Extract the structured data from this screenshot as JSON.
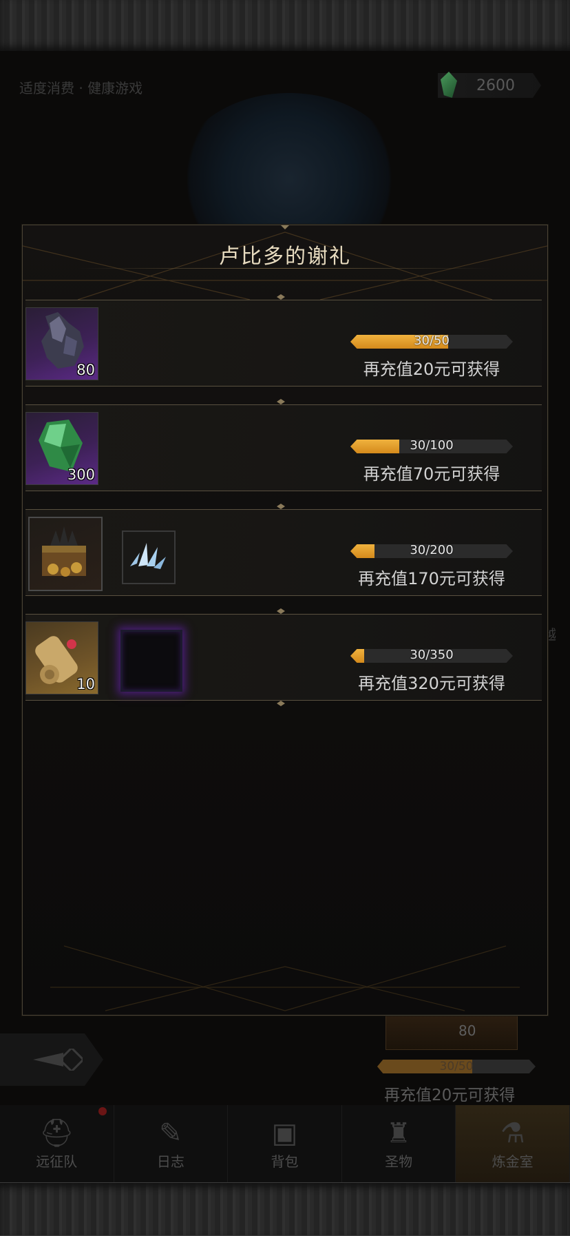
{
  "background": {
    "top_text": "适度消费 · 健康游戏",
    "currency_value": "2600",
    "side_char": "越",
    "lower_item_count": "80",
    "lower_progress": {
      "text": "30/50",
      "fraction": 0.6
    },
    "lower_hint": "再充值20元可获得"
  },
  "modal": {
    "title": "卢比多的谢礼",
    "rows": [
      {
        "items": [
          {
            "name": "dark-ore",
            "count": "80",
            "rarity": "purple"
          }
        ],
        "progress": {
          "current": 30,
          "target": 50,
          "text": "30/50",
          "fraction": 0.6
        },
        "hint": "再充值20元可获得"
      },
      {
        "items": [
          {
            "name": "green-crystal",
            "count": "300",
            "rarity": "purple"
          }
        ],
        "progress": {
          "current": 30,
          "target": 100,
          "text": "30/100",
          "fraction": 0.3
        },
        "hint": "再充值70元可获得"
      },
      {
        "items": [
          {
            "name": "treasure-chest",
            "count": "",
            "rarity": "dark"
          },
          {
            "name": "ice-crystal",
            "count": "",
            "rarity": "plain"
          }
        ],
        "progress": {
          "current": 30,
          "target": 200,
          "text": "30/200",
          "fraction": 0.15
        },
        "hint": "再充值170元可获得"
      },
      {
        "items": [
          {
            "name": "scroll",
            "count": "10",
            "rarity": "gold"
          },
          {
            "name": "void-frame",
            "count": "",
            "rarity": "void"
          }
        ],
        "progress": {
          "current": 30,
          "target": 350,
          "text": "30/350",
          "fraction": 0.0857
        },
        "hint": "再充值320元可获得"
      }
    ]
  },
  "nav": {
    "items": [
      {
        "label": "远征队",
        "icon": "helmet-icon"
      },
      {
        "label": "日志",
        "icon": "journal-icon"
      },
      {
        "label": "背包",
        "icon": "backpack-icon"
      },
      {
        "label": "圣物",
        "icon": "relic-icon"
      },
      {
        "label": "炼金室",
        "icon": "alchemy-icon",
        "active": true
      }
    ]
  },
  "colors": {
    "accent": "#e0a22f",
    "frame": "#4a4335",
    "title": "#e8dcc0"
  }
}
